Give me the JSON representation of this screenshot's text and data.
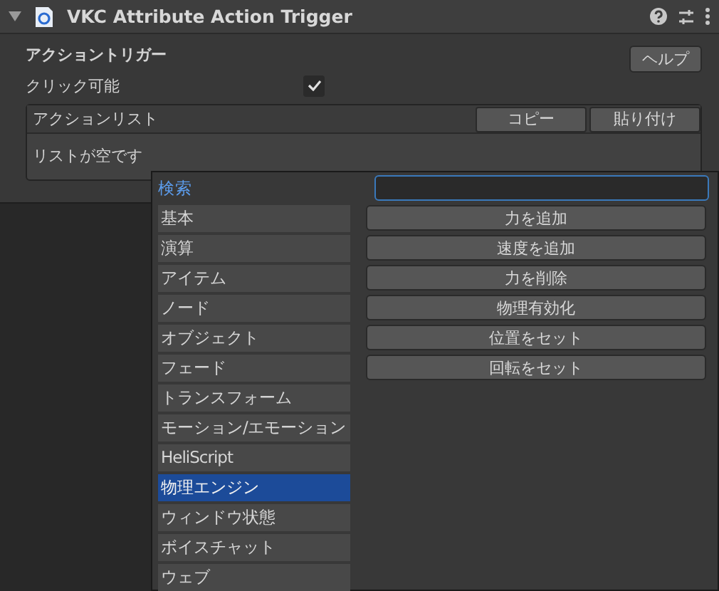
{
  "component": {
    "title": "VKC Attribute Action Trigger",
    "expanded": true
  },
  "section_title": "アクショントリガー",
  "help_button": "ヘルプ",
  "clickable": {
    "label": "クリック可能",
    "checked": true
  },
  "action_list": {
    "title": "アクションリスト",
    "buttons": [
      "コピー",
      "貼り付け"
    ],
    "empty_message": "リストが空です"
  },
  "picker": {
    "search_label": "検索",
    "categories": [
      {
        "label": "基本",
        "selected": false
      },
      {
        "label": "演算",
        "selected": false
      },
      {
        "label": "アイテム",
        "selected": false
      },
      {
        "label": "ノード",
        "selected": false
      },
      {
        "label": "オブジェクト",
        "selected": false
      },
      {
        "label": "フェード",
        "selected": false
      },
      {
        "label": "トランスフォーム",
        "selected": false
      },
      {
        "label": "モーション/エモーション",
        "selected": false
      },
      {
        "label": "HeliScript",
        "selected": false
      },
      {
        "label": "物理エンジン",
        "selected": true
      },
      {
        "label": "ウィンドウ状態",
        "selected": false
      },
      {
        "label": "ボイスチャット",
        "selected": false
      },
      {
        "label": "ウェブ",
        "selected": false
      }
    ],
    "actions": [
      "力を追加",
      "速度を追加",
      "力を削除",
      "物理有効化",
      "位置をセット",
      "回転をセット"
    ]
  }
}
